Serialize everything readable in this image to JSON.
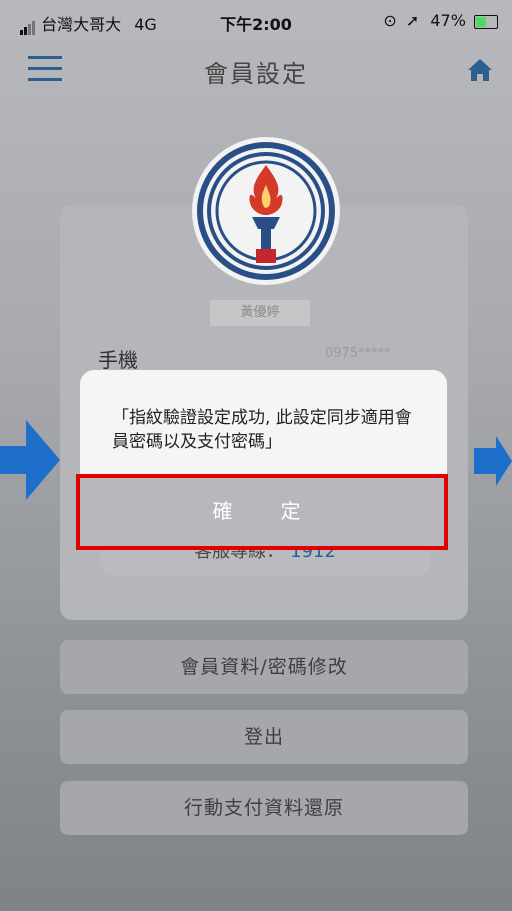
{
  "status_bar": {
    "carrier": "台灣大哥大",
    "network": "4G",
    "time": "下午2:00",
    "battery": "47%"
  },
  "header": {
    "title": "會員設定"
  },
  "profile": {
    "name": "黃優婷",
    "phone_label": "手機",
    "phone_value": "0975*****",
    "service_label": "客服專線：",
    "service_number": "1912"
  },
  "menu": {
    "items": [
      "會員資料/密碼修改",
      "登出",
      "行動支付資料還原"
    ]
  },
  "dialog": {
    "message": "「指紋驗證設定成功, 此設定同步適用會員密碼以及支付密碼」",
    "confirm_label": "確　定"
  },
  "colors": {
    "accent_blue": "#2a5f8f",
    "arrow_blue": "#1e6fc9",
    "highlight_red": "#e00000"
  }
}
